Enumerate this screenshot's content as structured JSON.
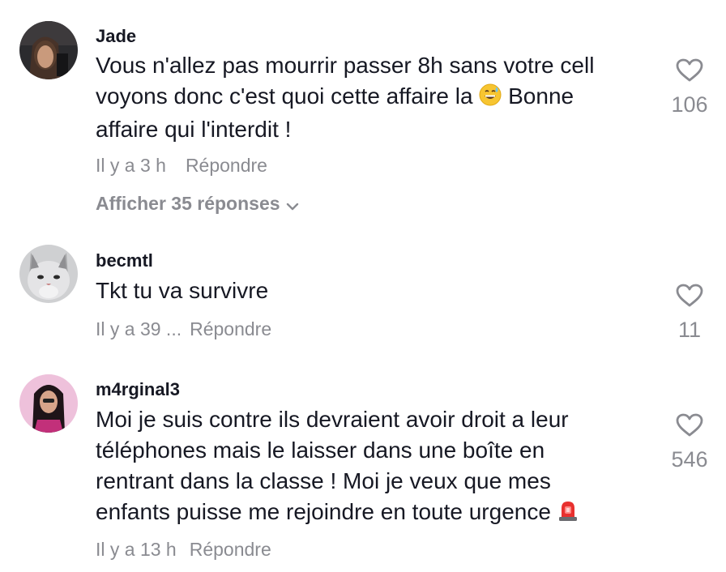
{
  "comments": [
    {
      "username": "Jade",
      "text_lines": [
        "Vous n'allez pas mourrir passer 8h sans votre cell",
        "voyons donc c'est quoi cette affaire la",
        "Bonne",
        "affaire qui l'interdit !"
      ],
      "emoji": "grinning-sweat-emoji",
      "time": "Il y a 3 h",
      "reply_label": "Répondre",
      "view_replies_label": "Afficher 35 réponses",
      "likes": "106"
    },
    {
      "username": "becmtl",
      "text_lines": [
        "Tkt tu va survivre"
      ],
      "time": "Il y a 39 ...",
      "reply_label": "Répondre",
      "likes": "11"
    },
    {
      "username": "m4rginal3",
      "text_lines": [
        "Moi je suis contre ils devraient avoir droit a leur",
        "téléphones mais le laisser dans une boîte en",
        "rentrant dans la classe ! Moi je veux que mes",
        "enfants puisse me rejoindre en toute urgence"
      ],
      "emoji": "rotating-light-emoji",
      "time": "Il y a 13 h",
      "reply_label": "Répondre",
      "likes": "546"
    }
  ],
  "colors": {
    "text": "#161823",
    "muted": "#8a8b91",
    "background": "#ffffff"
  },
  "icons": {
    "like": "heart-outline-icon",
    "expand": "chevron-down-icon"
  }
}
